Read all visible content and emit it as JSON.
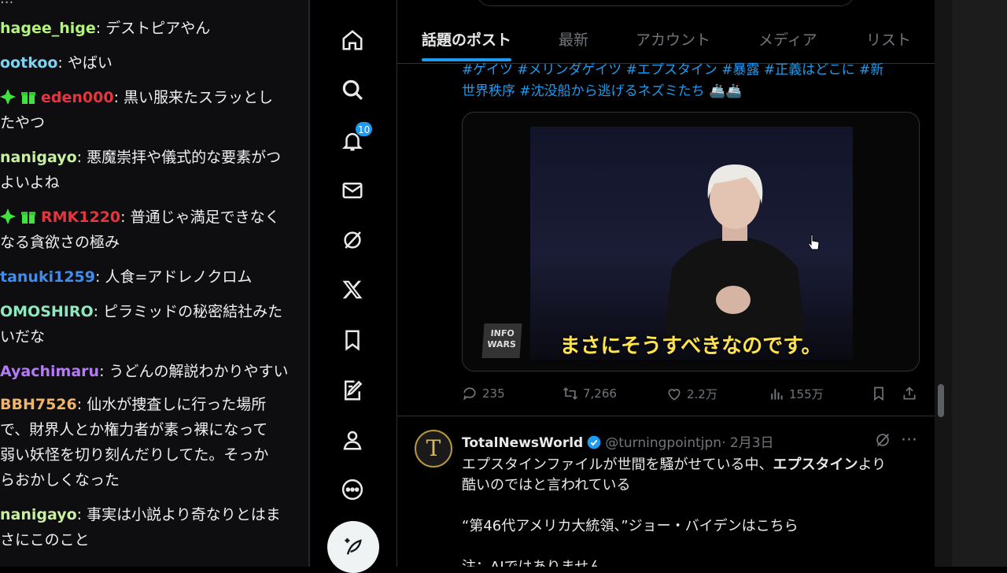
{
  "chat": {
    "top_fragment": "...",
    "messages": [
      {
        "user": "hagee_hige",
        "color": "#b3f47a",
        "sep": ": ",
        "lines": [
          "デストピアやん"
        ],
        "badges": false
      },
      {
        "user": "ootkoo",
        "color": "#7cd4f4",
        "sep": ": ",
        "lines": [
          "やばい"
        ],
        "badges": false
      },
      {
        "user": "eden000",
        "color": "#e5353f",
        "sep": ": ",
        "lines": [
          "黒い服来たスラッとし",
          "たやつ"
        ],
        "badges": true
      },
      {
        "user": "nanigayo",
        "color": "#c8f0a0",
        "sep": ": ",
        "lines": [
          "悪魔崇拝や儀式的な要素がつ",
          "よいよね"
        ],
        "badges": false
      },
      {
        "user": "RMK1220",
        "color": "#e5353f",
        "sep": ": ",
        "lines": [
          "普通じゃ満足できなく",
          "なる貪欲さの極み"
        ],
        "badges": true
      },
      {
        "user": "tanuki1259",
        "color": "#3d8ef0",
        "sep": ": ",
        "lines": [
          "人食=アドレノクロム"
        ],
        "badges": false
      },
      {
        "user": "OMOSHIRO",
        "color": "#8ee8c0",
        "sep": ": ",
        "lines": [
          "ピラミッドの秘密結社みた",
          "いだな"
        ],
        "badges": false
      },
      {
        "user": "Ayachimaru",
        "color": "#b57bf7",
        "sep": ": ",
        "lines": [
          "うどんの解説わかりやすい"
        ],
        "badges": false
      },
      {
        "user": "BBH7526",
        "color": "#f0b56a",
        "sep": ": ",
        "lines": [
          "仙水が捜査しに行った場所",
          "で、財界人とか権力者が素っ裸になって",
          "弱い妖怪を切り刻んだりしてた。そっか",
          "らおかしくなった"
        ],
        "badges": false
      },
      {
        "user": "nanigayo",
        "color": "#c8f0a0",
        "sep": ": ",
        "lines": [
          "事実は小説より奇なりとはま",
          "さにこのこと"
        ],
        "badges": false
      }
    ]
  },
  "nav": {
    "notifications_count": "10",
    "items": [
      "home-icon",
      "search-icon",
      "bell-icon",
      "mail-icon",
      "grok-icon",
      "x-logo-icon",
      "bookmark-icon",
      "communities-icon",
      "profile-icon",
      "more-icon"
    ]
  },
  "tabs": [
    {
      "label": "話題のポスト",
      "active": true
    },
    {
      "label": "最新",
      "active": false
    },
    {
      "label": "アカウント",
      "active": false
    },
    {
      "label": "メディア",
      "active": false
    },
    {
      "label": "リスト",
      "active": false
    }
  ],
  "post1": {
    "hashtags_line1": "#ゲイツ #メリンダゲイツ #エプスタイン #暴露 #正義はどこに #新",
    "hashtags_line2": "世界秩序 #沈没船から逃げるネズミたち 🚢🚢",
    "video_subtitle": "まさにそうすべきなのです。",
    "video_watermark": "INFO WARS",
    "replies": "235",
    "reposts": "7,266",
    "likes": "2.2万",
    "views": "155万"
  },
  "post2": {
    "avatar_letter": "T",
    "name": "TotalNewsWorld",
    "handle": "@turningpointjpn",
    "date": "· 2月3日",
    "line1_pre": "エプスタインファイルが世間を騒がせている中、",
    "line1_bold": "エプスタイン",
    "line1_post": "より",
    "line2": "酷いのではと言われている",
    "line3": "“第46代アメリカ大統領、”ジョー・バイデンはこちら",
    "line4": "注：AIではありません"
  },
  "colors": {
    "accent": "#1d9bf0",
    "subtitle": "#ffe34d"
  }
}
